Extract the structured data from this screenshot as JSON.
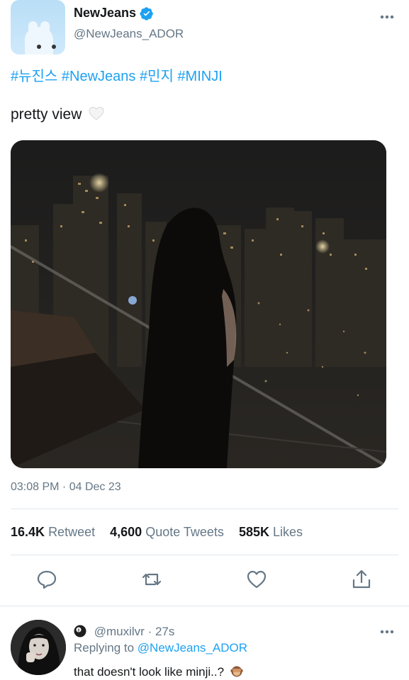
{
  "account": {
    "display_name": "NewJeans",
    "handle": "@NewJeans_ADOR",
    "verified_icon": "verified-badge-icon"
  },
  "tweet": {
    "hashtags": "#뉴진스 #NewJeans #민지 #MINJI",
    "text": "pretty view",
    "text_emoji": "white-heart-icon",
    "timestamp": "03:08 PM · 04 Dec 23"
  },
  "stats": {
    "retweets_count": "16.4K",
    "retweets_label": "Retweet",
    "quotes_count": "4,600",
    "quotes_label": "Quote Tweets",
    "likes_count": "585K",
    "likes_label": "Likes"
  },
  "actions": [
    "reply-icon",
    "retweet-icon",
    "like-icon",
    "share-icon"
  ],
  "reply": {
    "handle": "@muxilvr",
    "time": "· 27s",
    "replying_prefix": "Replying to",
    "replying_to": "@NewJeans_ADOR",
    "text": "that doesn't look like minji..?",
    "text_emoji": "see-no-evil-monkey-icon"
  },
  "colors": {
    "accent": "#1da1f2",
    "muted": "#657786",
    "text": "#14171a",
    "divider": "#e1e8ed"
  }
}
